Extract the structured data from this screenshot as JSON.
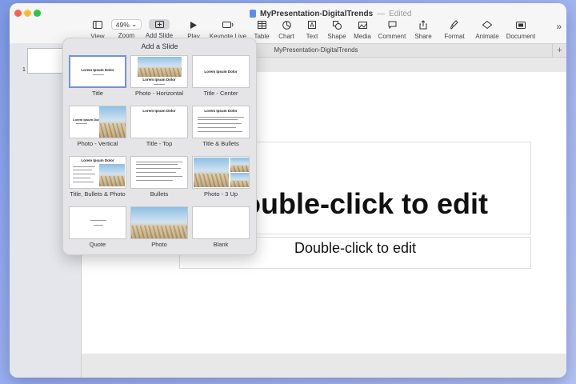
{
  "window": {
    "doc_name": "MyPresentation-DigitalTrends",
    "separator": "—",
    "status": "Edited"
  },
  "toolbar": {
    "zoom_value": "49%",
    "items": [
      {
        "label": "View",
        "icon": "sidebar-icon"
      },
      {
        "label": "Zoom",
        "icon": "zoom-icon"
      },
      {
        "label": "Add Slide",
        "icon": "add-slide-icon"
      },
      {
        "label": "Play",
        "icon": "play-icon"
      },
      {
        "label": "Keynote Live",
        "icon": "keynote-live-icon"
      },
      {
        "label": "Table",
        "icon": "table-icon"
      },
      {
        "label": "Chart",
        "icon": "chart-icon"
      },
      {
        "label": "Text",
        "icon": "text-icon"
      },
      {
        "label": "Shape",
        "icon": "shape-icon"
      },
      {
        "label": "Media",
        "icon": "media-icon"
      },
      {
        "label": "Comment",
        "icon": "comment-icon"
      },
      {
        "label": "Share",
        "icon": "share-icon"
      },
      {
        "label": "Format",
        "icon": "format-icon"
      },
      {
        "label": "Animate",
        "icon": "animate-icon"
      },
      {
        "label": "Document",
        "icon": "document-icon"
      }
    ]
  },
  "tab_title": "MyPresentation-DigitalTrends",
  "tab_add": "+",
  "navigator": {
    "slide_number": "1"
  },
  "slide": {
    "title_placeholder": "Double-click to edit",
    "subtitle_placeholder": "Double-click to edit"
  },
  "popover": {
    "title": "Add a Slide",
    "layouts": [
      {
        "name": "Title"
      },
      {
        "name": "Photo - Horizontal"
      },
      {
        "name": "Title - Center"
      },
      {
        "name": "Photo - Vertical"
      },
      {
        "name": "Title - Top"
      },
      {
        "name": "Title & Bullets"
      },
      {
        "name": "Title, Bullets & Photo"
      },
      {
        "name": "Bullets"
      },
      {
        "name": "Photo - 3 Up"
      },
      {
        "name": "Quote"
      },
      {
        "name": "Photo"
      },
      {
        "name": "Blank"
      }
    ],
    "thumb_title": "Lorem Ipsum Dolor"
  }
}
